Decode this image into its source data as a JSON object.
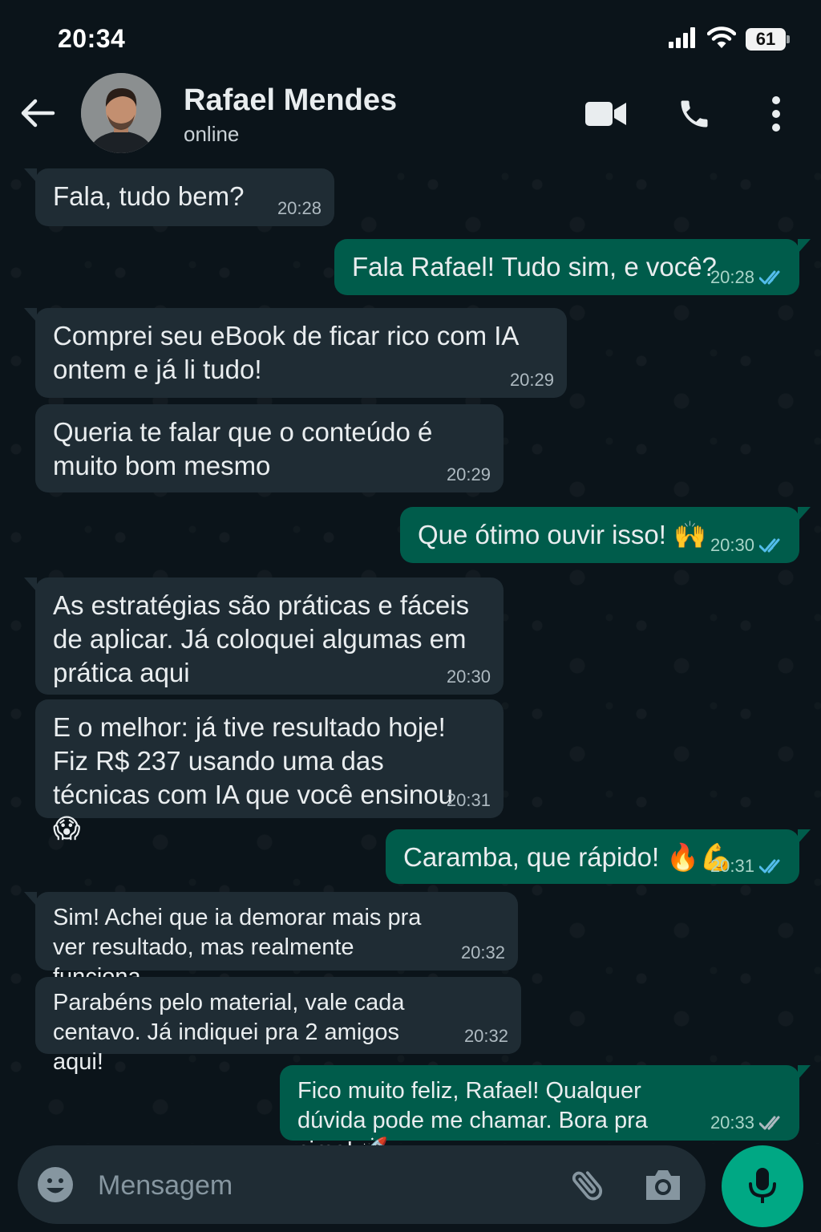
{
  "status_bar": {
    "time": "20:34",
    "battery": "61",
    "icons": [
      "signal-icon",
      "wifi-icon",
      "battery-icon"
    ]
  },
  "header": {
    "back_icon": "arrow-left-icon",
    "contact_name": "Rafael Mendes",
    "contact_status": "online",
    "actions": [
      "video-call-icon",
      "phone-icon",
      "more-vertical-icon"
    ]
  },
  "messages": [
    {
      "direction": "incoming",
      "text": "Fala, tudo bem?",
      "time": "20:28"
    },
    {
      "direction": "outgoing",
      "text": "Fala Rafael! Tudo sim, e você?",
      "time": "20:28",
      "status": "read"
    },
    {
      "direction": "incoming",
      "text": "Comprei seu eBook de ficar rico com IA ontem e já li tudo!",
      "time": "20:29"
    },
    {
      "direction": "incoming",
      "text": "Queria te falar que o conteúdo é muito bom mesmo",
      "time": "20:29"
    },
    {
      "direction": "outgoing",
      "text": "Que ótimo ouvir isso! 🙌",
      "time": "20:30",
      "status": "read"
    },
    {
      "direction": "incoming",
      "text": "As estratégias são práticas e fáceis de aplicar. Já coloquei algumas em prática aqui",
      "time": "20:30"
    },
    {
      "direction": "incoming",
      "text": "E o melhor: já tive resultado hoje! Fiz R$ 237 usando uma das técnicas com IA que você ensinou 😱",
      "time": "20:31"
    },
    {
      "direction": "outgoing",
      "text": "Caramba, que rápido! 🔥💪",
      "time": "20:31",
      "status": "read"
    },
    {
      "direction": "incoming",
      "text": "Sim! Achei que ia demorar mais pra ver resultado, mas realmente funciona",
      "time": "20:32"
    },
    {
      "direction": "incoming",
      "text": "Parabéns pelo material, vale cada centavo. Já indiquei pra 2 amigos aqui!",
      "time": "20:32"
    },
    {
      "direction": "outgoing",
      "text": "Fico muito feliz, Rafael! Qualquer dúvida pode me chamar. Bora pra cima! 🚀",
      "time": "20:33",
      "status": "delivered"
    }
  ],
  "input_bar": {
    "placeholder": "Mensagem",
    "icons": [
      "emoji-icon",
      "paperclip-icon",
      "camera-icon",
      "mic-icon"
    ]
  },
  "colors": {
    "background": "#0b141a",
    "incoming_bubble": "#1f2c34",
    "outgoing_bubble": "#005c4b",
    "accent": "#00a884",
    "read_ticks": "#53bdeb",
    "delivered_ticks": "#aebac1"
  }
}
